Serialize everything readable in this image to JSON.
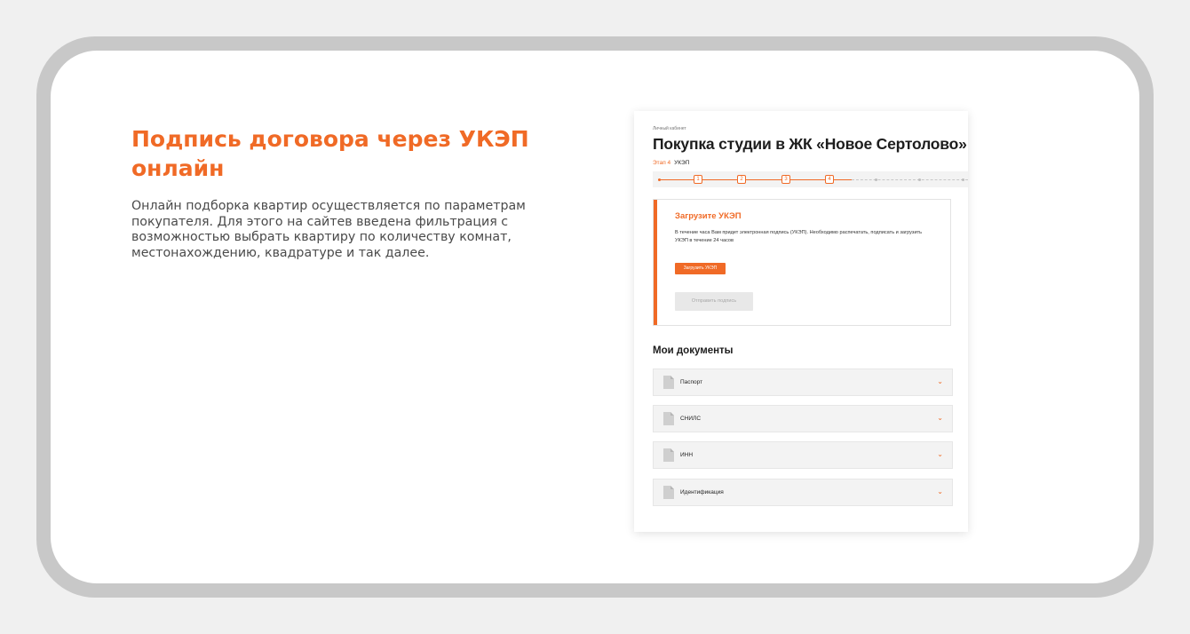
{
  "headline": "Подпись договора через УКЭП онлайн",
  "description": "Онлайн подборка квартир осуществляется по параметрам покупателя. Для этого на сайтев введена фильтрация с возможностью выбрать квартиру по количеству комнат, местонахождению, квадратуре и так далее.",
  "panel": {
    "breadcrumb": "Личный кабинет",
    "title": "Покупка студии в ЖК «Новое Сертолово»",
    "stage_number": "Этап 4",
    "stage_name": "УКЭП",
    "steps": [
      "1",
      "2",
      "3",
      "4"
    ],
    "upload": {
      "title": "Загрузите УКЭП",
      "text": "В течение часа Вам придет электронная подпись (УКЭП). Необходимо распечатать, подписать и загрузить УКЭП в течение 24 часов",
      "upload_button": "Загрузить УКЭП",
      "send_button": "Отправить подпись"
    },
    "docs_title": "Мои документы",
    "documents": [
      "Паспорт",
      "СНИЛС",
      "ИНН",
      "Идентификация"
    ]
  },
  "colors": {
    "accent": "#f06a26",
    "frame": "#c8c8c8",
    "background": "#f0f0f0"
  }
}
